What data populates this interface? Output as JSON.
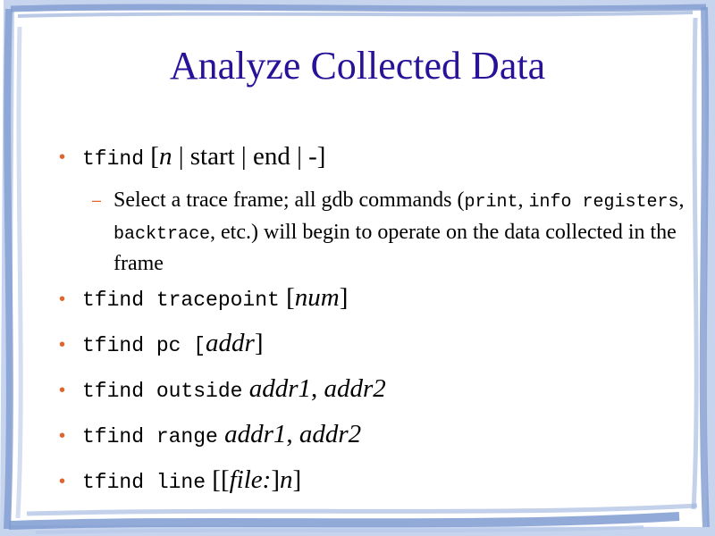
{
  "title": "Analyze Collected Data",
  "colors": {
    "title": "#2a1199",
    "bullet": "#e0652c",
    "frame": "#7f9bd0",
    "frame_light": "#c7d4ee"
  },
  "bullets": [
    {
      "cmd": "tfind",
      "parts": [
        " [",
        "n",
        " | start | end | -]"
      ]
    },
    {
      "sub_parts": [
        "Select a trace frame; all gdb commands (",
        "print",
        ", ",
        "info registers",
        ", ",
        "backtrace",
        ", etc.) will begin to operate on the data collected in the frame"
      ]
    },
    {
      "cmd": "tfind tracepoint",
      "parts": [
        " [",
        "num",
        "]"
      ]
    },
    {
      "cmd": "tfind pc [",
      "parts": [
        "addr",
        "]"
      ]
    },
    {
      "cmd": "tfind outside",
      "parts": [
        " addr1",
        ", ",
        "addr2"
      ]
    },
    {
      "cmd": "tfind range",
      "parts": [
        " addr1",
        ", ",
        "addr2"
      ]
    },
    {
      "cmd": "tfind line",
      "parts": [
        " [[",
        "file:",
        "]",
        "n",
        "]"
      ]
    }
  ]
}
